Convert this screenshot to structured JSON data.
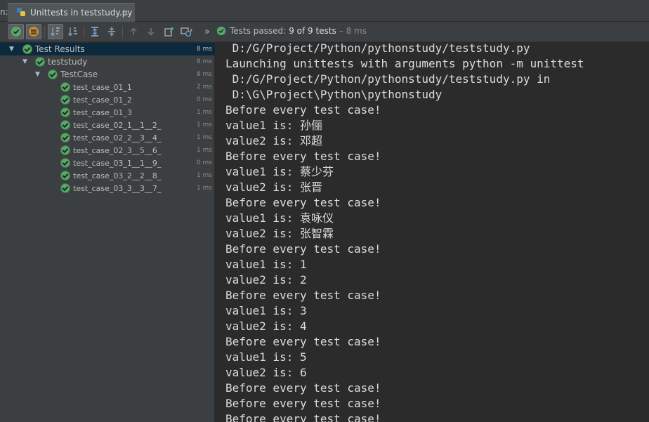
{
  "tabbar": {
    "prefix": "n:",
    "tab_title": "Unittests in teststudy.py",
    "close": "×"
  },
  "toolbar": {
    "status_text": "Tests passed:",
    "status_count": "9 of 9 tests",
    "status_time": "– 8 ms",
    "more": "»"
  },
  "tree": {
    "root": {
      "label": "Test Results",
      "duration": "8 ms"
    },
    "module": {
      "label": "teststudy",
      "duration": "8 ms"
    },
    "case": {
      "label": "TestCase",
      "duration": "8 ms"
    },
    "tests": [
      {
        "label": "test_case_01_1",
        "duration": "2 ms"
      },
      {
        "label": "test_case_01_2",
        "duration": "0 ms"
      },
      {
        "label": "test_case_01_3",
        "duration": "1 ms"
      },
      {
        "label": "test_case_02_1__1__2_",
        "duration": "1 ms"
      },
      {
        "label": "test_case_02_2__3__4_",
        "duration": "1 ms"
      },
      {
        "label": "test_case_02_3__5__6_",
        "duration": "1 ms"
      },
      {
        "label": "test_case_03_1__1__9_",
        "duration": "0 ms"
      },
      {
        "label": "test_case_03_2__2__8_",
        "duration": "1 ms"
      },
      {
        "label": "test_case_03_3__3__7_",
        "duration": "1 ms"
      }
    ]
  },
  "console": {
    "lines": [
      " D:/G/Project/Python/pythonstudy/teststudy.py",
      "Launching unittests with arguments python -m unittest",
      " D:/G/Project/Python/pythonstudy/teststudy.py in",
      " D:\\G\\Project\\Python\\pythonstudy",
      "Before every test case!",
      "value1 is: 孙俪",
      "value2 is: 邓超",
      "Before every test case!",
      "value1 is: 蔡少芬",
      "value2 is: 张晋",
      "Before every test case!",
      "value1 is: 袁咏仪",
      "value2 is: 张智霖",
      "Before every test case!",
      "value1 is: 1",
      "value2 is: 2",
      "Before every test case!",
      "value1 is: 3",
      "value2 is: 4",
      "Before every test case!",
      "value1 is: 5",
      "value2 is: 6",
      "Before every test case!",
      "Before every test case!",
      "Before every test case!"
    ]
  },
  "colors": {
    "pass": "#59a869",
    "selection": "#0d293e",
    "panel": "#3c3f41",
    "console_bg": "#2b2b2b"
  }
}
